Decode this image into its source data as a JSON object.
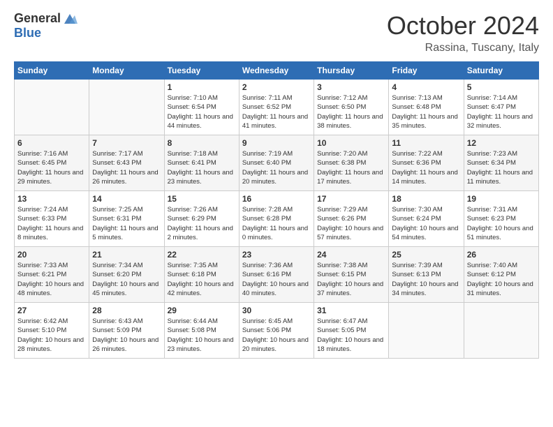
{
  "logo": {
    "general": "General",
    "blue": "Blue"
  },
  "title": "October 2024",
  "subtitle": "Rassina, Tuscany, Italy",
  "headers": [
    "Sunday",
    "Monday",
    "Tuesday",
    "Wednesday",
    "Thursday",
    "Friday",
    "Saturday"
  ],
  "weeks": [
    [
      {
        "day": "",
        "info": ""
      },
      {
        "day": "",
        "info": ""
      },
      {
        "day": "1",
        "info": "Sunrise: 7:10 AM\nSunset: 6:54 PM\nDaylight: 11 hours and 44 minutes."
      },
      {
        "day": "2",
        "info": "Sunrise: 7:11 AM\nSunset: 6:52 PM\nDaylight: 11 hours and 41 minutes."
      },
      {
        "day": "3",
        "info": "Sunrise: 7:12 AM\nSunset: 6:50 PM\nDaylight: 11 hours and 38 minutes."
      },
      {
        "day": "4",
        "info": "Sunrise: 7:13 AM\nSunset: 6:48 PM\nDaylight: 11 hours and 35 minutes."
      },
      {
        "day": "5",
        "info": "Sunrise: 7:14 AM\nSunset: 6:47 PM\nDaylight: 11 hours and 32 minutes."
      }
    ],
    [
      {
        "day": "6",
        "info": "Sunrise: 7:16 AM\nSunset: 6:45 PM\nDaylight: 11 hours and 29 minutes."
      },
      {
        "day": "7",
        "info": "Sunrise: 7:17 AM\nSunset: 6:43 PM\nDaylight: 11 hours and 26 minutes."
      },
      {
        "day": "8",
        "info": "Sunrise: 7:18 AM\nSunset: 6:41 PM\nDaylight: 11 hours and 23 minutes."
      },
      {
        "day": "9",
        "info": "Sunrise: 7:19 AM\nSunset: 6:40 PM\nDaylight: 11 hours and 20 minutes."
      },
      {
        "day": "10",
        "info": "Sunrise: 7:20 AM\nSunset: 6:38 PM\nDaylight: 11 hours and 17 minutes."
      },
      {
        "day": "11",
        "info": "Sunrise: 7:22 AM\nSunset: 6:36 PM\nDaylight: 11 hours and 14 minutes."
      },
      {
        "day": "12",
        "info": "Sunrise: 7:23 AM\nSunset: 6:34 PM\nDaylight: 11 hours and 11 minutes."
      }
    ],
    [
      {
        "day": "13",
        "info": "Sunrise: 7:24 AM\nSunset: 6:33 PM\nDaylight: 11 hours and 8 minutes."
      },
      {
        "day": "14",
        "info": "Sunrise: 7:25 AM\nSunset: 6:31 PM\nDaylight: 11 hours and 5 minutes."
      },
      {
        "day": "15",
        "info": "Sunrise: 7:26 AM\nSunset: 6:29 PM\nDaylight: 11 hours and 2 minutes."
      },
      {
        "day": "16",
        "info": "Sunrise: 7:28 AM\nSunset: 6:28 PM\nDaylight: 11 hours and 0 minutes."
      },
      {
        "day": "17",
        "info": "Sunrise: 7:29 AM\nSunset: 6:26 PM\nDaylight: 10 hours and 57 minutes."
      },
      {
        "day": "18",
        "info": "Sunrise: 7:30 AM\nSunset: 6:24 PM\nDaylight: 10 hours and 54 minutes."
      },
      {
        "day": "19",
        "info": "Sunrise: 7:31 AM\nSunset: 6:23 PM\nDaylight: 10 hours and 51 minutes."
      }
    ],
    [
      {
        "day": "20",
        "info": "Sunrise: 7:33 AM\nSunset: 6:21 PM\nDaylight: 10 hours and 48 minutes."
      },
      {
        "day": "21",
        "info": "Sunrise: 7:34 AM\nSunset: 6:20 PM\nDaylight: 10 hours and 45 minutes."
      },
      {
        "day": "22",
        "info": "Sunrise: 7:35 AM\nSunset: 6:18 PM\nDaylight: 10 hours and 42 minutes."
      },
      {
        "day": "23",
        "info": "Sunrise: 7:36 AM\nSunset: 6:16 PM\nDaylight: 10 hours and 40 minutes."
      },
      {
        "day": "24",
        "info": "Sunrise: 7:38 AM\nSunset: 6:15 PM\nDaylight: 10 hours and 37 minutes."
      },
      {
        "day": "25",
        "info": "Sunrise: 7:39 AM\nSunset: 6:13 PM\nDaylight: 10 hours and 34 minutes."
      },
      {
        "day": "26",
        "info": "Sunrise: 7:40 AM\nSunset: 6:12 PM\nDaylight: 10 hours and 31 minutes."
      }
    ],
    [
      {
        "day": "27",
        "info": "Sunrise: 6:42 AM\nSunset: 5:10 PM\nDaylight: 10 hours and 28 minutes."
      },
      {
        "day": "28",
        "info": "Sunrise: 6:43 AM\nSunset: 5:09 PM\nDaylight: 10 hours and 26 minutes."
      },
      {
        "day": "29",
        "info": "Sunrise: 6:44 AM\nSunset: 5:08 PM\nDaylight: 10 hours and 23 minutes."
      },
      {
        "day": "30",
        "info": "Sunrise: 6:45 AM\nSunset: 5:06 PM\nDaylight: 10 hours and 20 minutes."
      },
      {
        "day": "31",
        "info": "Sunrise: 6:47 AM\nSunset: 5:05 PM\nDaylight: 10 hours and 18 minutes."
      },
      {
        "day": "",
        "info": ""
      },
      {
        "day": "",
        "info": ""
      }
    ]
  ]
}
